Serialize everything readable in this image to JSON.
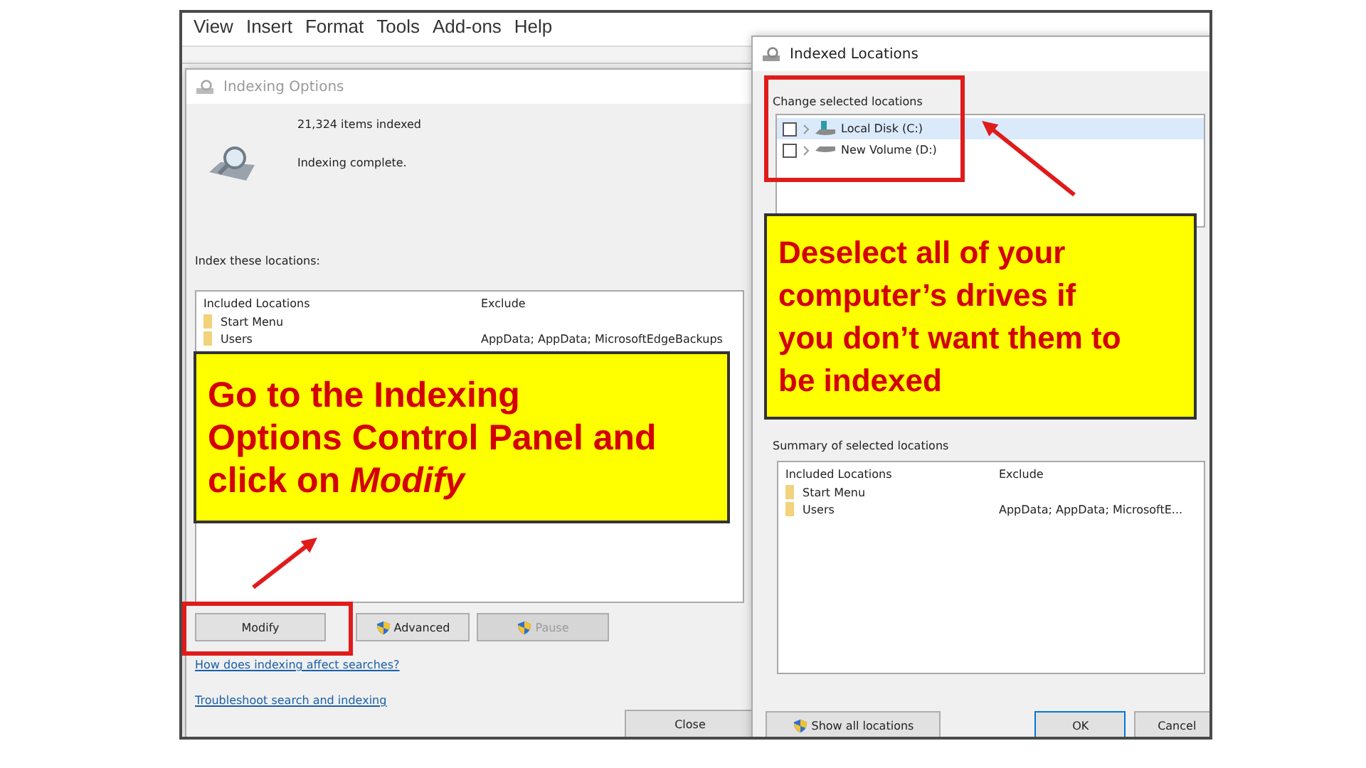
{
  "menu_bar": [
    "View",
    "Insert",
    "Format",
    "Tools",
    "Add-ons",
    "Help"
  ],
  "indexing_options": {
    "title": "Indexing Options",
    "items_indexed": "21,324 items indexed",
    "status": "Indexing complete.",
    "section_label": "Index these locations:",
    "columns": [
      "Included Locations",
      "Exclude"
    ],
    "rows": [
      {
        "location": "Start Menu",
        "exclude": ""
      },
      {
        "location": "Users",
        "exclude": "AppData; AppData; MicrosoftEdgeBackups"
      }
    ],
    "buttons": [
      {
        "label": "Modify",
        "shield": false,
        "disabled": false
      },
      {
        "label": "Advanced",
        "shield": true,
        "disabled": false
      },
      {
        "label": "Pause",
        "shield": true,
        "disabled": true
      }
    ],
    "links": [
      "How does indexing affect searches?",
      "Troubleshoot search and indexing"
    ],
    "close_button": "Close"
  },
  "indexed_locations": {
    "title": "Indexed Locations",
    "change_label": "Change selected locations",
    "tree": [
      {
        "label": "Local Disk (C:)",
        "checked": false,
        "expanded": false,
        "selected": true
      },
      {
        "label": "New Volume (D:)",
        "checked": false,
        "expanded": false,
        "selected": false
      }
    ],
    "summary_label": "Summary of selected locations",
    "columns": [
      "Included Locations",
      "Exclude"
    ],
    "rows": [
      {
        "location": "Start Menu",
        "exclude": ""
      },
      {
        "location": "Users",
        "exclude": "AppData; AppData; MicrosoftE..."
      }
    ],
    "buttons": [
      {
        "label": "Show all locations",
        "shield": true
      },
      {
        "label": "OK",
        "shield": false
      },
      {
        "label": "Cancel",
        "shield": false
      }
    ]
  },
  "callouts": [
    {
      "text": "Go to the Indexing\nOptions Control Panel and\nclick on *Modify*"
    },
    {
      "text": "Deselect all of your\ncomputer’s drives if\nyou don’t want them to\nbe indexed"
    }
  ]
}
